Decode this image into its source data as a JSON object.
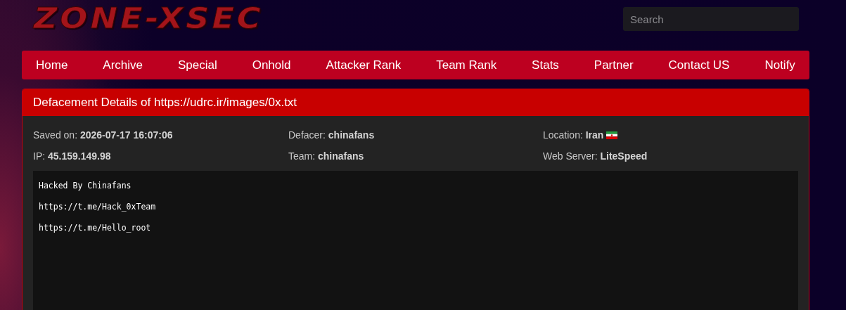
{
  "logo": "ZONE-XSEC",
  "search": {
    "placeholder": "Search"
  },
  "nav": [
    "Home",
    "Archive",
    "Special",
    "Onhold",
    "Attacker Rank",
    "Team Rank",
    "Stats",
    "Partner",
    "Contact US",
    "Notify"
  ],
  "panel": {
    "title": "Defacement Details of https://udrc.ir/images/0x.txt",
    "details": [
      {
        "label": "Saved on:",
        "value": "2026-07-17 16:07:06",
        "flag": false
      },
      {
        "label": "Defacer:",
        "value": "chinafans",
        "flag": false
      },
      {
        "label": "Location:",
        "value": "Iran",
        "flag": true
      },
      {
        "label": "IP:",
        "value": "45.159.149.98",
        "flag": false
      },
      {
        "label": "Team:",
        "value": "chinafans",
        "flag": false
      },
      {
        "label": "Web Server:",
        "value": "LiteSpeed",
        "flag": false
      }
    ],
    "content": [
      "Hacked By Chinafans",
      "https://t.me/Hack_0xTeam",
      "https://t.me/Hello_root"
    ]
  }
}
